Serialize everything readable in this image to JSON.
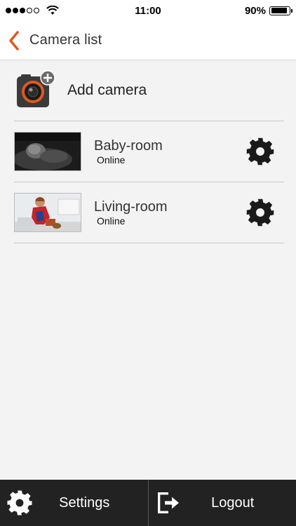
{
  "status_bar": {
    "time": "11:00",
    "battery_percent_label": "90%",
    "battery_level": 0.9,
    "signal_bars_filled": 3,
    "signal_bars_total": 5
  },
  "nav": {
    "title": "Camera list",
    "accent_color": "#e0581b"
  },
  "add_camera": {
    "label": "Add camera"
  },
  "cameras": [
    {
      "name": "Baby-room",
      "status": "Online"
    },
    {
      "name": "Living-room",
      "status": "Online"
    }
  ],
  "bottom_bar": {
    "settings_label": "Settings",
    "logout_label": "Logout"
  }
}
